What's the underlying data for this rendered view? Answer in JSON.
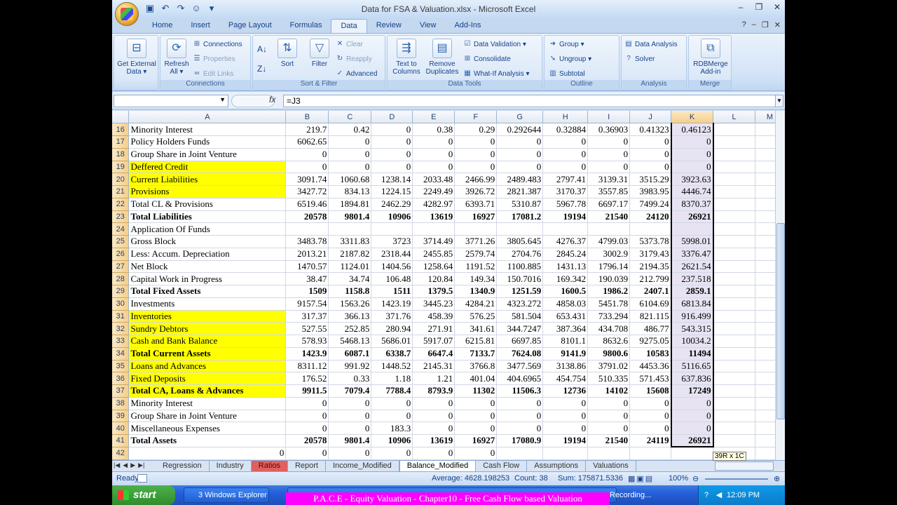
{
  "window": {
    "title": "Data for FSA & Valuation.xlsx - Microsoft Excel"
  },
  "ribbon_tabs": [
    "Home",
    "Insert",
    "Page Layout",
    "Formulas",
    "Data",
    "Review",
    "View",
    "Add-Ins"
  ],
  "active_tab": "Data",
  "ribbon": {
    "get_external": {
      "line1": "Get External",
      "line2": "Data ▾"
    },
    "refresh": {
      "line1": "Refresh",
      "line2": "All ▾"
    },
    "connections": "Connections",
    "properties": "Properties",
    "edit_links": "Edit Links",
    "group_connections": "Connections",
    "sort": "Sort",
    "filter": "Filter",
    "clear": "Clear",
    "reapply": "Reapply",
    "advanced": "Advanced",
    "group_sort": "Sort & Filter",
    "text_to_cols": {
      "line1": "Text to",
      "line2": "Columns"
    },
    "remove_dup": {
      "line1": "Remove",
      "line2": "Duplicates"
    },
    "data_validation": "Data Validation ▾",
    "consolidate": "Consolidate",
    "whatif": "What-If Analysis ▾",
    "group_tools": "Data Tools",
    "group_btn": "Group ▾",
    "ungroup": "Ungroup ▾",
    "subtotal": "Subtotal",
    "group_outline": "Outline",
    "data_analysis": "Data Analysis",
    "solver": "Solver",
    "group_analysis": "Analysis",
    "rdb": {
      "line1": "RDBMerge",
      "line2": "Add-in"
    },
    "group_merge": "Merge"
  },
  "formula_bar": {
    "name_box": "",
    "fx": "fx",
    "content": "=J3"
  },
  "columns": [
    "A",
    "B",
    "C",
    "D",
    "E",
    "F",
    "G",
    "H",
    "I",
    "J",
    "K",
    "L",
    "M"
  ],
  "rows": [
    {
      "n": "16",
      "label": "Minority Interest",
      "yellow": false,
      "bold": false,
      "v": [
        "219.7",
        "0.42",
        "0",
        "0.38",
        "0.29",
        "0.292644",
        "0.32884",
        "0.36903",
        "0.41323",
        "0.46123"
      ]
    },
    {
      "n": "17",
      "label": "Policy Holders Funds",
      "yellow": false,
      "bold": false,
      "v": [
        "6062.65",
        "0",
        "0",
        "0",
        "0",
        "0",
        "0",
        "0",
        "0",
        "0"
      ]
    },
    {
      "n": "18",
      "label": "Group Share in Joint Venture",
      "yellow": false,
      "bold": false,
      "v": [
        "0",
        "0",
        "0",
        "0",
        "0",
        "0",
        "0",
        "0",
        "0",
        "0"
      ]
    },
    {
      "n": "19",
      "label": "Deffered Credit",
      "yellow": true,
      "bold": false,
      "v": [
        "0",
        "0",
        "0",
        "0",
        "0",
        "0",
        "0",
        "0",
        "0",
        "0"
      ]
    },
    {
      "n": "20",
      "label": "Current Liabilities",
      "yellow": true,
      "bold": false,
      "v": [
        "3091.74",
        "1060.68",
        "1238.14",
        "2033.48",
        "2466.99",
        "2489.483",
        "2797.41",
        "3139.31",
        "3515.29",
        "3923.63"
      ]
    },
    {
      "n": "21",
      "label": "Provisions",
      "yellow": true,
      "bold": false,
      "v": [
        "3427.72",
        "834.13",
        "1224.15",
        "2249.49",
        "3926.72",
        "2821.387",
        "3170.37",
        "3557.85",
        "3983.95",
        "4446.74"
      ]
    },
    {
      "n": "22",
      "label": "Total CL & Provisions",
      "yellow": false,
      "bold": false,
      "v": [
        "6519.46",
        "1894.81",
        "2462.29",
        "4282.97",
        "6393.71",
        "5310.87",
        "5967.78",
        "6697.17",
        "7499.24",
        "8370.37"
      ]
    },
    {
      "n": "23",
      "label": "Total Liabilities",
      "yellow": false,
      "bold": true,
      "v": [
        "20578",
        "9801.4",
        "10906",
        "13619",
        "16927",
        "17081.2",
        "19194",
        "21540",
        "24120",
        "26921"
      ]
    },
    {
      "n": "24",
      "label": "Application Of Funds",
      "yellow": false,
      "bold": false,
      "v": [
        "",
        "",
        "",
        "",
        "",
        "",
        "",
        "",
        "",
        ""
      ]
    },
    {
      "n": "25",
      "label": "Gross Block",
      "yellow": false,
      "bold": false,
      "v": [
        "3483.78",
        "3311.83",
        "3723",
        "3714.49",
        "3771.26",
        "3805.645",
        "4276.37",
        "4799.03",
        "5373.78",
        "5998.01"
      ]
    },
    {
      "n": "26",
      "label": "Less: Accum. Depreciation",
      "yellow": false,
      "bold": false,
      "v": [
        "2013.21",
        "2187.82",
        "2318.44",
        "2455.85",
        "2579.74",
        "2704.76",
        "2845.24",
        "3002.9",
        "3179.43",
        "3376.47"
      ]
    },
    {
      "n": "27",
      "label": "Net Block",
      "yellow": false,
      "bold": false,
      "v": [
        "1470.57",
        "1124.01",
        "1404.56",
        "1258.64",
        "1191.52",
        "1100.885",
        "1431.13",
        "1796.14",
        "2194.35",
        "2621.54"
      ]
    },
    {
      "n": "28",
      "label": "Capital Work in Progress",
      "yellow": false,
      "bold": false,
      "v": [
        "38.47",
        "34.74",
        "106.48",
        "120.84",
        "149.34",
        "150.7016",
        "169.342",
        "190.039",
        "212.799",
        "237.518"
      ]
    },
    {
      "n": "29",
      "label": "Total Fixed Assets",
      "yellow": false,
      "bold": true,
      "v": [
        "1509",
        "1158.8",
        "1511",
        "1379.5",
        "1340.9",
        "1251.59",
        "1600.5",
        "1986.2",
        "2407.1",
        "2859.1"
      ]
    },
    {
      "n": "30",
      "label": "Investments",
      "yellow": false,
      "bold": false,
      "v": [
        "9157.54",
        "1563.26",
        "1423.19",
        "3445.23",
        "4284.21",
        "4323.272",
        "4858.03",
        "5451.78",
        "6104.69",
        "6813.84"
      ]
    },
    {
      "n": "31",
      "label": "Inventories",
      "yellow": true,
      "bold": false,
      "v": [
        "317.37",
        "366.13",
        "371.76",
        "458.39",
        "576.25",
        "581.504",
        "653.431",
        "733.294",
        "821.115",
        "916.499"
      ]
    },
    {
      "n": "32",
      "label": "Sundry Debtors",
      "yellow": true,
      "bold": false,
      "v": [
        "527.55",
        "252.85",
        "280.94",
        "271.91",
        "341.61",
        "344.7247",
        "387.364",
        "434.708",
        "486.77",
        "543.315"
      ]
    },
    {
      "n": "33",
      "label": "Cash and Bank Balance",
      "yellow": true,
      "bold": false,
      "v": [
        "578.93",
        "5468.13",
        "5686.01",
        "5917.07",
        "6215.81",
        "6697.85",
        "8101.1",
        "8632.6",
        "9275.05",
        "10034.2"
      ]
    },
    {
      "n": "34",
      "label": "Total Current Assets",
      "yellow": true,
      "bold": true,
      "v": [
        "1423.9",
        "6087.1",
        "6338.7",
        "6647.4",
        "7133.7",
        "7624.08",
        "9141.9",
        "9800.6",
        "10583",
        "11494"
      ]
    },
    {
      "n": "35",
      "label": "Loans and Advances",
      "yellow": true,
      "bold": false,
      "v": [
        "8311.12",
        "991.92",
        "1448.52",
        "2145.31",
        "3766.8",
        "3477.569",
        "3138.86",
        "3791.02",
        "4453.36",
        "5116.65"
      ]
    },
    {
      "n": "36",
      "label": "Fixed Deposits",
      "yellow": true,
      "bold": false,
      "v": [
        "176.52",
        "0.33",
        "1.18",
        "1.21",
        "401.04",
        "404.6965",
        "454.754",
        "510.335",
        "571.453",
        "637.836"
      ]
    },
    {
      "n": "37",
      "label": "Total CA, Loans & Advances",
      "yellow": true,
      "bold": true,
      "v": [
        "9911.5",
        "7079.4",
        "7788.4",
        "8793.9",
        "11302",
        "11506.3",
        "12736",
        "14102",
        "15608",
        "17249"
      ]
    },
    {
      "n": "38",
      "label": "Minority Interest",
      "yellow": false,
      "bold": false,
      "v": [
        "0",
        "0",
        "0",
        "0",
        "0",
        "0",
        "0",
        "0",
        "0",
        "0"
      ]
    },
    {
      "n": "39",
      "label": "Group Share in Joint Venture",
      "yellow": false,
      "bold": false,
      "v": [
        "0",
        "0",
        "0",
        "0",
        "0",
        "0",
        "0",
        "0",
        "0",
        "0"
      ]
    },
    {
      "n": "40",
      "label": "Miscellaneous Expenses",
      "yellow": false,
      "bold": false,
      "v": [
        "0",
        "0",
        "183.3",
        "0",
        "0",
        "0",
        "0",
        "0",
        "0",
        "0"
      ]
    },
    {
      "n": "41",
      "label": "Total Assets",
      "yellow": false,
      "bold": true,
      "v": [
        "20578",
        "9801.4",
        "10906",
        "13619",
        "16927",
        "17080.9",
        "19194",
        "21540",
        "24119",
        "26921"
      ]
    },
    {
      "n": "42",
      "label": "0",
      "yellow": false,
      "bold": false,
      "v": [
        "0",
        "0",
        "0",
        "0",
        "0",
        "",
        "",
        "",
        "",
        ""
      ]
    }
  ],
  "sheet_tabs": [
    "Regression",
    "Industry",
    "Ratios",
    "Report",
    "Income_Modified",
    "Balance_Modified",
    "Cash Flow",
    "Assumptions",
    "Valuations"
  ],
  "active_sheet": "Balance_Modified",
  "tooltip": "39R x 1C",
  "status": {
    "ready": "Ready",
    "average": "Average: 4628.198253",
    "count": "Count: 38",
    "sum": "Sum: 175871.5336",
    "zoom": "100%"
  },
  "taskbar": {
    "start": "start",
    "explorer": "3 Windows Explorer",
    "recording": "Recording...",
    "clock": "12:09 PM",
    "banner": "P.A.C.E - Equity Valuation - Chapter10 - Free Cash Flow based Valuation"
  }
}
